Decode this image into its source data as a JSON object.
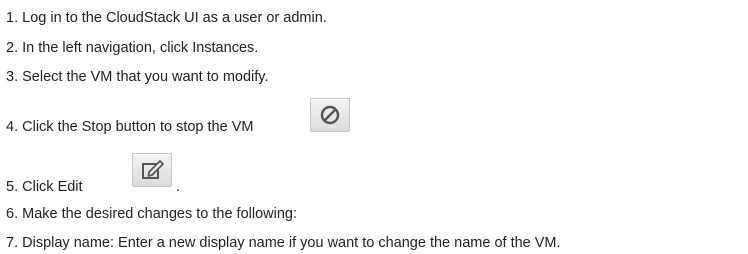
{
  "steps": [
    {
      "num": "1.",
      "text": "Log in to the CloudStack UI as a user or admin."
    },
    {
      "num": "2.",
      "text": "In the left navigation, click Instances."
    },
    {
      "num": "3.",
      "text": "Select the VM that you want to modify."
    },
    {
      "num": "4.",
      "text": "Click the Stop button to stop the VM"
    },
    {
      "num": "5.",
      "text": "Click Edit",
      "suffix": "."
    },
    {
      "num": "6.",
      "text": "Make the desired changes to the following:"
    },
    {
      "num": "7.",
      "text": "Display name: Enter a new display name if you want to change the name of the VM."
    }
  ],
  "icons": {
    "stop": "stop-icon",
    "edit": "edit-icon"
  },
  "colors": {
    "text": "#222222",
    "button_border": "#c4c4c4",
    "icon_stroke": "#555555"
  }
}
